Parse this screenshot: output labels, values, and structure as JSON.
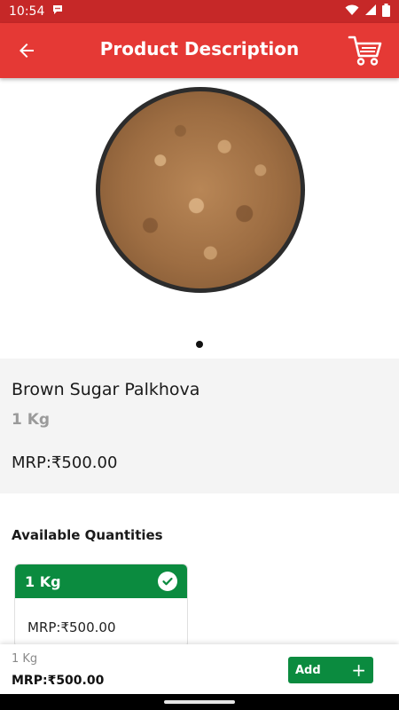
{
  "status_bar": {
    "time": "10:54"
  },
  "app_bar": {
    "title": "Product Description",
    "back_icon": "arrow-left-icon",
    "cart_icon": "shopping-cart-icon"
  },
  "product": {
    "name": "Brown Sugar Palkhova",
    "weight": "1 Kg",
    "mrp": "MRP:₹500.00",
    "image_pages": 1,
    "current_image_page": 1
  },
  "quantities": {
    "section_title": "Available Quantities",
    "options": [
      {
        "label": "1 Kg",
        "price": "MRP:₹500.00",
        "selected": true
      }
    ]
  },
  "bottom_bar": {
    "weight": "1 Kg",
    "mrp": "MRP:₹500.00",
    "add_label": "Add",
    "add_icon": "plus-icon"
  },
  "colors": {
    "status_bar": "#c62828",
    "app_bar": "#e53935",
    "accent_green": "#0b8b3f",
    "panel_bg": "#f4f4f4"
  }
}
